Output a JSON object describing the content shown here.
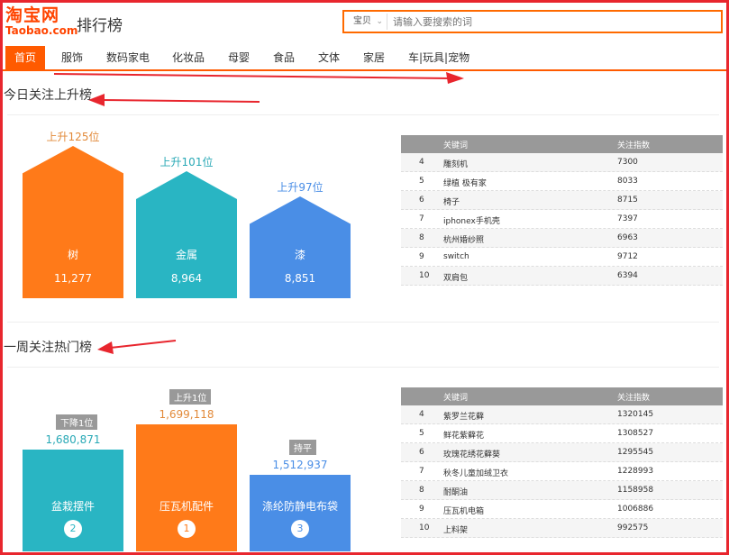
{
  "logo": {
    "top": "淘宝网",
    "bottom": "Taobao.com"
  },
  "page_title": "排行榜",
  "search": {
    "category": "宝贝",
    "placeholder": "请输入要搜索的词"
  },
  "nav": [
    "首页",
    "服饰",
    "数码家电",
    "化妆品",
    "母婴",
    "食品",
    "文体",
    "家居",
    "车|玩具|宠物"
  ],
  "section1": {
    "title": "今日关注上升榜",
    "bars": [
      {
        "rise": "上升125位",
        "name": "树",
        "value": "11,277",
        "color": "#ff7a19"
      },
      {
        "rise": "上升101位",
        "name": "金属",
        "value": "8,964",
        "color": "#29b5c3"
      },
      {
        "rise": "上升97位",
        "name": "漆",
        "value": "8,851",
        "color": "#4a8ee6"
      }
    ],
    "table": {
      "headers": [
        "关键词",
        "关注指数"
      ],
      "rows": [
        {
          "rank": "4",
          "keyword": "雕刻机",
          "index": "7300"
        },
        {
          "rank": "5",
          "keyword": "绿植 极有家",
          "index": "8033"
        },
        {
          "rank": "6",
          "keyword": "椅子",
          "index": "8715"
        },
        {
          "rank": "7",
          "keyword": "iphonex手机壳",
          "index": "7397"
        },
        {
          "rank": "8",
          "keyword": "杭州婚纱照",
          "index": "6963"
        },
        {
          "rank": "9",
          "keyword": "switch",
          "index": "9712"
        },
        {
          "rank": "10",
          "keyword": "双肩包",
          "index": "6394"
        }
      ]
    }
  },
  "section2": {
    "title": "一周关注热门榜",
    "bars": [
      {
        "tag": "下降1位",
        "value": "1,680,871",
        "name": "盆栽摆件",
        "rank": "2",
        "color": "#29b5c3"
      },
      {
        "tag": "上升1位",
        "value": "1,699,118",
        "name": "压瓦机配件",
        "rank": "1",
        "color": "#ff7a19"
      },
      {
        "tag": "持平",
        "value": "1,512,937",
        "name": "涤纶防静电布袋",
        "rank": "3",
        "color": "#4a8ee6"
      }
    ],
    "table": {
      "headers": [
        "关键词",
        "关注指数"
      ],
      "rows": [
        {
          "rank": "4",
          "keyword": "紫罗兰花藓",
          "index": "1320145"
        },
        {
          "rank": "5",
          "keyword": "鲜花紫藓花",
          "index": "1308527"
        },
        {
          "rank": "6",
          "keyword": "玫瑰花绣花藓葵",
          "index": "1295545"
        },
        {
          "rank": "7",
          "keyword": "秋冬儿童加绒卫衣",
          "index": "1228993"
        },
        {
          "rank": "8",
          "keyword": "耐酮油",
          "index": "1158958"
        },
        {
          "rank": "9",
          "keyword": "压瓦机电箱",
          "index": "1006886"
        },
        {
          "rank": "10",
          "keyword": "上料架",
          "index": "992575"
        }
      ]
    }
  }
}
